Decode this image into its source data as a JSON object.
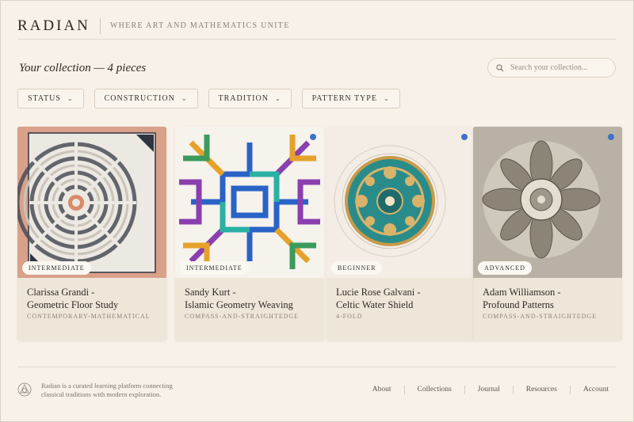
{
  "header": {
    "logo": "RADIAN",
    "tagline": "WHERE ART AND MATHEMATICS UNITE"
  },
  "collection": {
    "title": "Your collection — 4 pieces",
    "search_placeholder": "Search your collection..."
  },
  "filters": [
    {
      "label": "STATUS"
    },
    {
      "label": "CONSTRUCTION"
    },
    {
      "label": "TRADITION"
    },
    {
      "label": "PATTERN TYPE"
    }
  ],
  "cards": [
    {
      "level": "INTERMEDIATE",
      "title_line1": "Clarissa Grandi -",
      "title_line2": "Geometric Floor Study",
      "subtitle": "CONTEMPORARY-MATHEMATICAL",
      "image": "concentric circle weave floor"
    },
    {
      "level": "INTERMEDIATE",
      "title_line1": "Sandy Kurt -",
      "title_line2": "Islamic Geometry Weaving",
      "subtitle": "COMPASS-AND-STRAIGHTEDGE",
      "image": "colorful interlaced star pattern"
    },
    {
      "level": "BEGINNER",
      "title_line1": "Lucie Rose Galvani -",
      "title_line2": "Celtic Water Shield",
      "subtitle": "4-FOLD",
      "image": "teal and gold celtic shield"
    },
    {
      "level": "ADVANCED",
      "title_line1": "Adam Williamson -",
      "title_line2": "Profound Patterns",
      "subtitle": "COMPASS-AND-STRAIGHTEDGE",
      "image": "carved stone floral rosette"
    }
  ],
  "footer": {
    "text": "Radian is a curated learning platform connecting classical traditions with modern exploration.",
    "links": [
      "About",
      "Collections",
      "Journal",
      "Resources",
      "Account"
    ]
  },
  "colors": {
    "background": "#f7f1e8",
    "card": "#efe6da",
    "accent_dot": "#3e72c8"
  }
}
